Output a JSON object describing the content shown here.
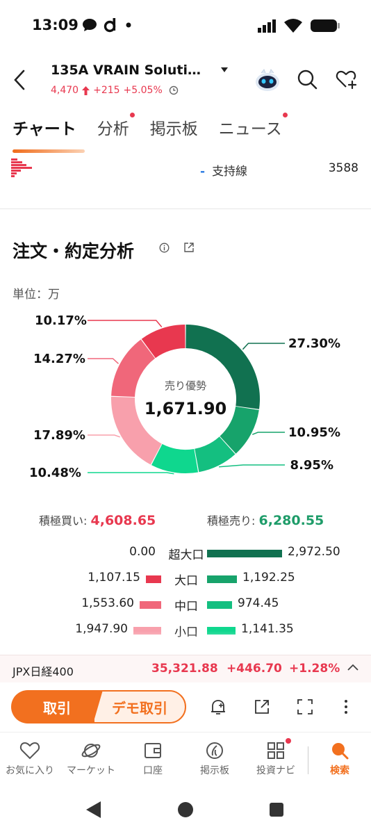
{
  "status_bar": {
    "time": "13:09"
  },
  "header": {
    "stock_name": "135A  VRAIN Soluti…",
    "price": "4,470",
    "change": "+215",
    "change_pct": "+5.05%"
  },
  "tabs": [
    {
      "label": "チャート",
      "active": true,
      "dot": false
    },
    {
      "label": "分析",
      "active": false,
      "dot": true
    },
    {
      "label": "掲示板",
      "active": false,
      "dot": false
    },
    {
      "label": "ニュース",
      "active": false,
      "dot": true
    }
  ],
  "support": {
    "label": "支持線",
    "value": "3588"
  },
  "order_section": {
    "title": "注文・約定分析",
    "unit": "単位：万",
    "center_label": "売り優勢",
    "center_value": "1,671.90",
    "buy_label": "積極買い:",
    "buy_value": "4,608.65",
    "sell_label": "積極売り:",
    "sell_value": "6,280.55",
    "rows": [
      {
        "category": "超大口",
        "buy": "0.00",
        "sell": "2,972.50",
        "buy_frac": 0.0,
        "sell_frac": 1.0,
        "buy_color": "#e8384f",
        "sell_color": "#117150"
      },
      {
        "category": "大口",
        "buy": "1,107.15",
        "sell": "1,192.25",
        "buy_frac": 0.37,
        "sell_frac": 0.4,
        "buy_color": "#e8384f",
        "sell_color": "#17a36b"
      },
      {
        "category": "中口",
        "buy": "1,553.60",
        "sell": "974.45",
        "buy_frac": 0.52,
        "sell_frac": 0.33,
        "buy_color": "#f0677a",
        "sell_color": "#14bf80"
      },
      {
        "category": "小口",
        "buy": "1,947.90",
        "sell": "1,141.35",
        "buy_frac": 0.66,
        "sell_frac": 0.38,
        "buy_color": "#f8a0ac",
        "sell_color": "#0fd78e"
      }
    ]
  },
  "chart_data": {
    "type": "pie",
    "donut": true,
    "slices": [
      {
        "label": "27.30%",
        "value": 27.3,
        "color": "#117150"
      },
      {
        "label": "10.95%",
        "value": 10.95,
        "color": "#17a36b"
      },
      {
        "label": "8.95%",
        "value": 8.95,
        "color": "#14bf80"
      },
      {
        "label": "10.48%",
        "value": 10.48,
        "color": "#0fd78e"
      },
      {
        "label": "17.89%",
        "value": 17.89,
        "color": "#f8a0ac"
      },
      {
        "label": "14.27%",
        "value": 14.27,
        "color": "#f0677a"
      },
      {
        "label": "10.17%",
        "value": 10.17,
        "color": "#e8384f"
      }
    ]
  },
  "ticker": {
    "name": "JPX日経400",
    "value": "35,321.88",
    "change": "+446.70",
    "change_pct": "+1.28%"
  },
  "action_bar": {
    "trade_label": "取引",
    "demo_label": "デモ取引"
  },
  "bottom_nav": [
    {
      "label": "お気に入り",
      "icon": "heart-icon"
    },
    {
      "label": "マーケット",
      "icon": "planet-icon"
    },
    {
      "label": "口座",
      "icon": "wallet-icon"
    },
    {
      "label": "掲示板",
      "icon": "board-icon"
    },
    {
      "label": "投資ナビ",
      "icon": "grid-icon"
    },
    {
      "label": "検索",
      "icon": "search-icon",
      "active": true
    }
  ]
}
